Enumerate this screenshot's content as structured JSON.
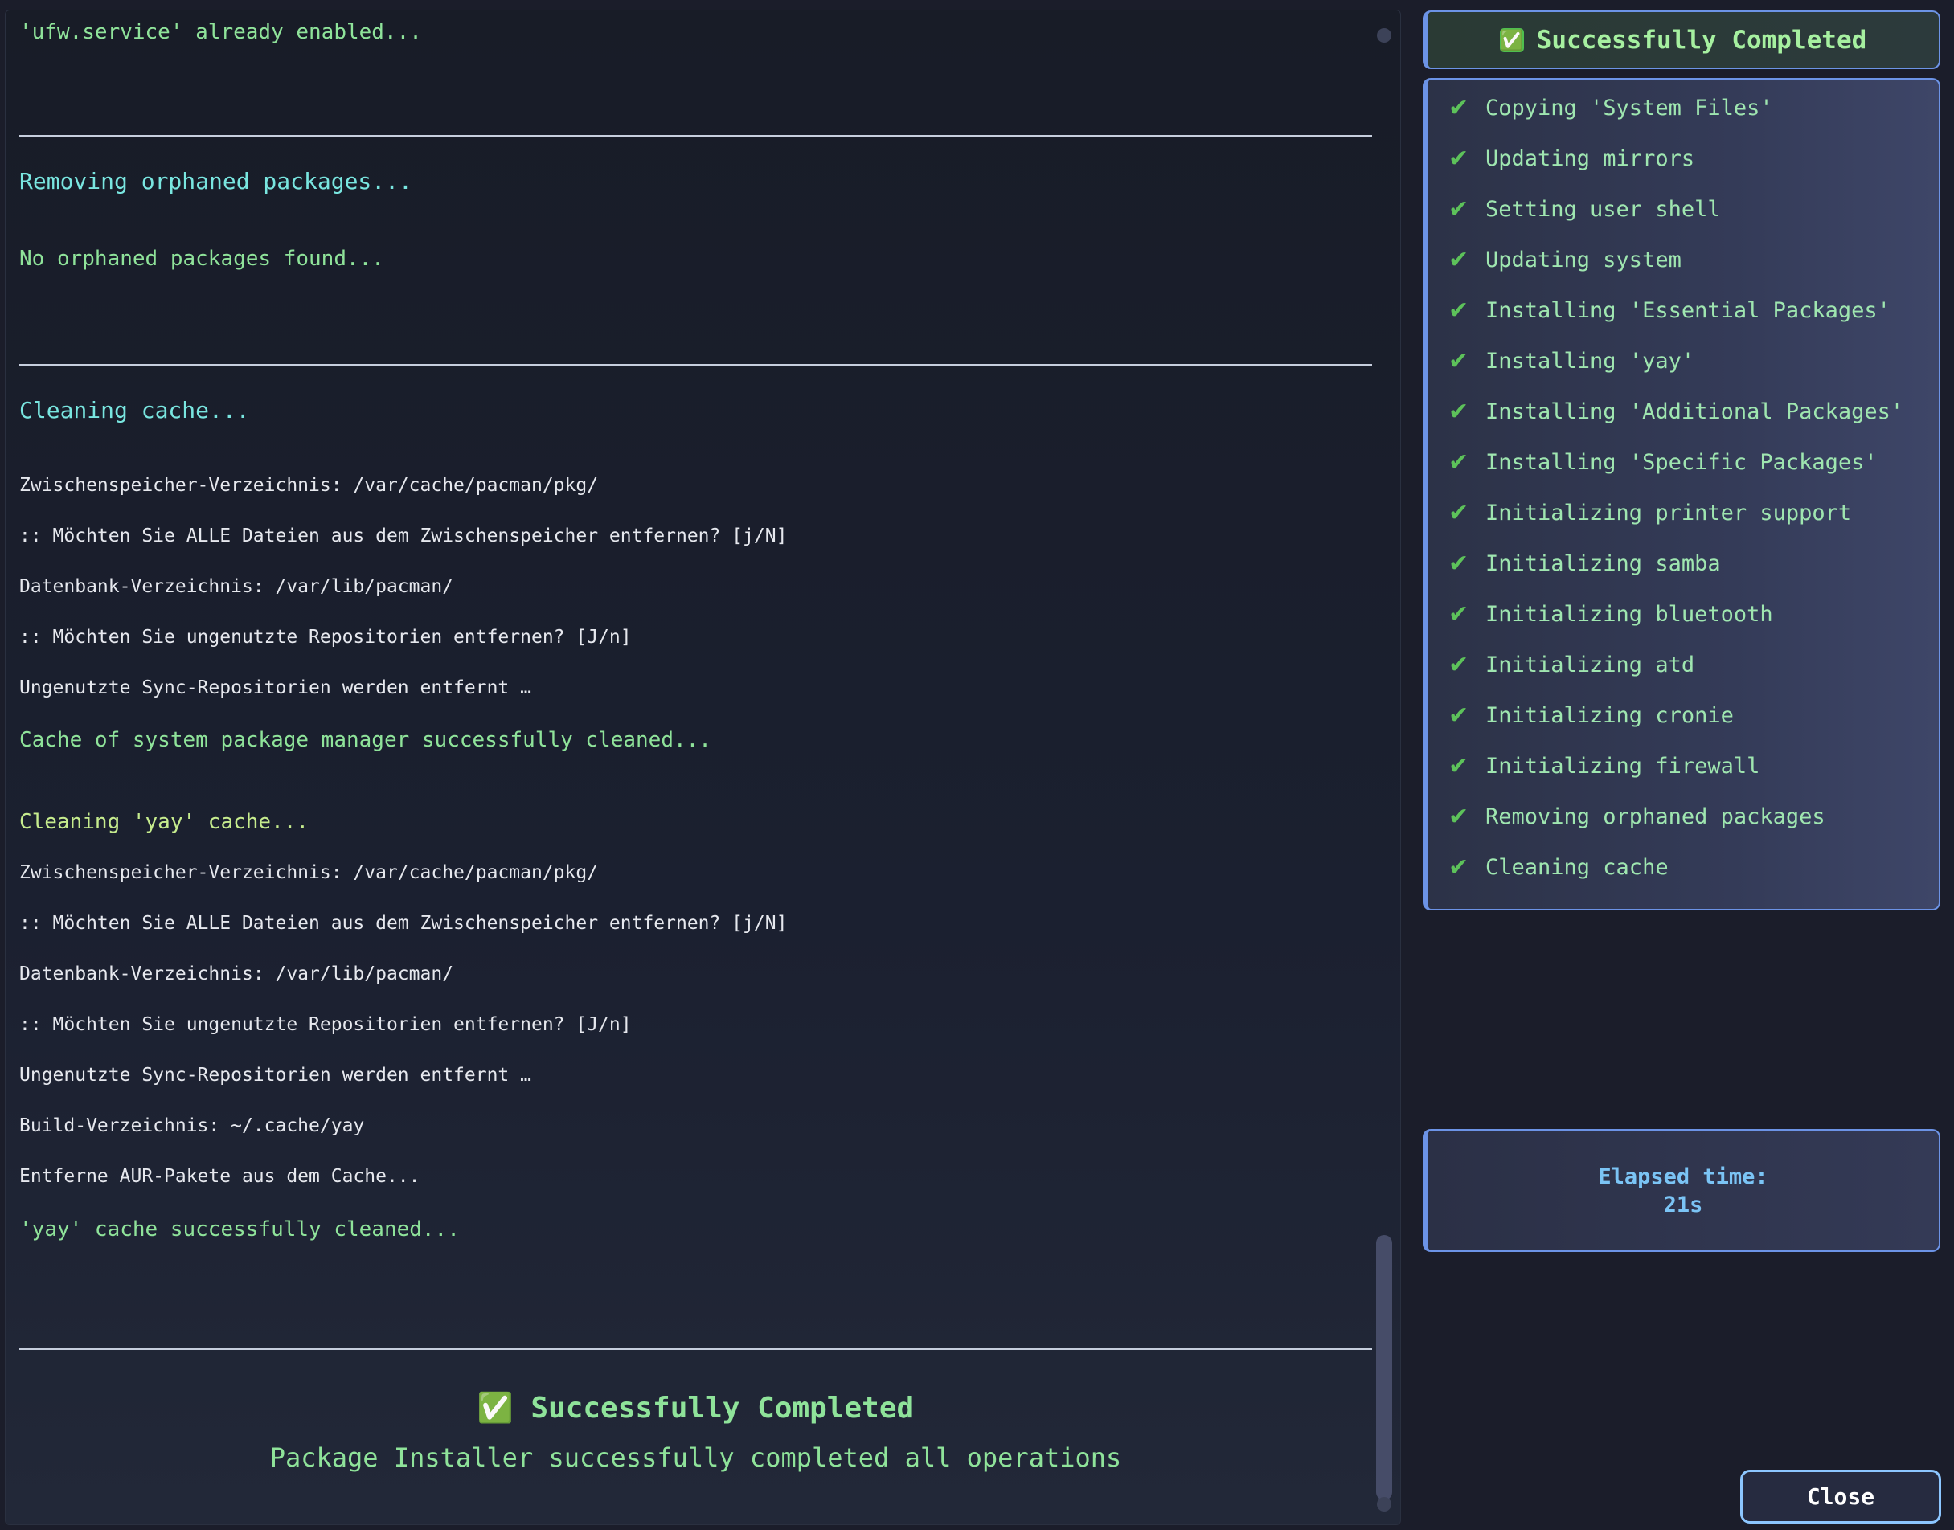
{
  "terminal": {
    "lines": {
      "l1": "'ufw.service' already enabled...",
      "l2": "Removing orphaned packages...",
      "l3": "No orphaned packages found...",
      "l4": "Cleaning cache...",
      "l5": "Zwischenspeicher-Verzeichnis: /var/cache/pacman/pkg/",
      "l6": ":: Möchten Sie ALLE Dateien aus dem Zwischenspeicher entfernen? [j/N]",
      "l7": "Datenbank-Verzeichnis: /var/lib/pacman/",
      "l8": ":: Möchten Sie ungenutzte Repositorien entfernen? [J/n]",
      "l9": "Ungenutzte Sync-Repositorien werden entfernt …",
      "l10": "Cache of system package manager successfully cleaned...",
      "l11": "Cleaning 'yay' cache...",
      "l12": "Zwischenspeicher-Verzeichnis: /var/cache/pacman/pkg/",
      "l13": ":: Möchten Sie ALLE Dateien aus dem Zwischenspeicher entfernen? [j/N]",
      "l14": "Datenbank-Verzeichnis: /var/lib/pacman/",
      "l15": ":: Möchten Sie ungenutzte Repositorien entfernen? [J/n]",
      "l16": "Ungenutzte Sync-Repositorien werden entfernt …",
      "l17": "Build-Verzeichnis: ~/.cache/yay",
      "l18": "Entferne AUR-Pakete aus dem Cache...",
      "l19": "'yay' cache successfully cleaned..."
    },
    "final_emoji": "✅",
    "final_title": "Successfully Completed",
    "final_subtitle": "Package Installer successfully completed all operations"
  },
  "sidebar": {
    "status_emoji": "✅",
    "status_title": "Successfully Completed",
    "check_icon": "✔",
    "steps": [
      "Copying 'System Files'",
      "Updating mirrors",
      "Setting user shell",
      "Updating system",
      "Installing 'Essential Packages'",
      "Installing 'yay'",
      "Installing 'Additional Packages'",
      "Installing 'Specific Packages'",
      "Initializing printer support",
      "Initializing samba",
      "Initializing bluetooth",
      "Initializing atd",
      "Initializing cronie",
      "Initializing firewall",
      "Removing orphaned packages",
      "Cleaning cache"
    ],
    "elapsed_label": "Elapsed time:",
    "elapsed_value": "21s"
  },
  "buttons": {
    "close_label": "Close"
  },
  "colors": {
    "success_green": "#8fe39a",
    "heading_cyan": "#79e6e0",
    "accent_blue": "#6c93e6",
    "check_green": "#5dc25a"
  }
}
